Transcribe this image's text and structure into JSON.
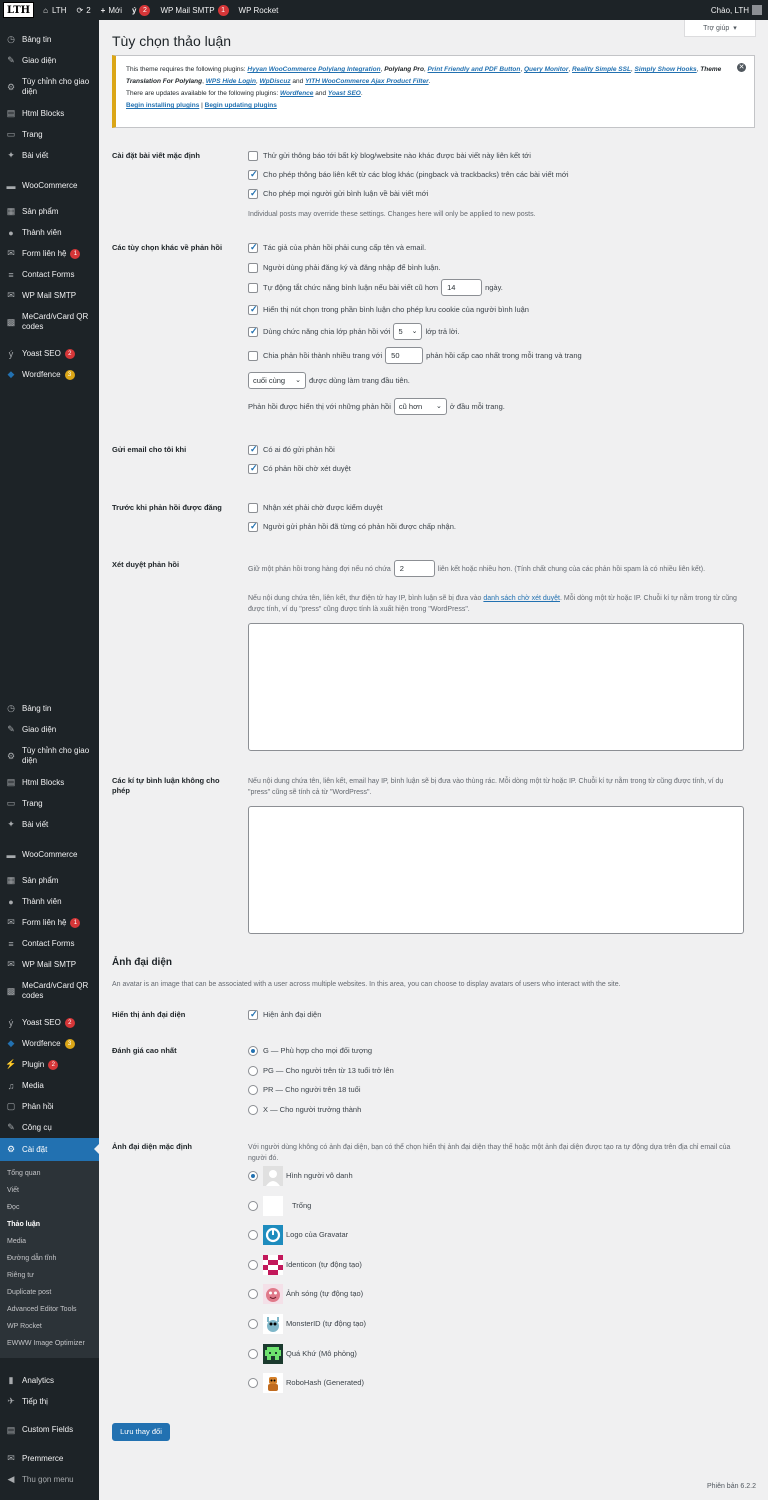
{
  "adminbar": {
    "logo": "LTH",
    "site_name": "LTH",
    "updates_count": "2",
    "new_label": "Mới",
    "yoast_count": "2",
    "smtp_label": "WP Mail SMTP",
    "smtp_count": "1",
    "rocket_label": "WP Rocket",
    "greeting": "Chào, LTH"
  },
  "sidebar": {
    "top_items": [
      {
        "label": "Bảng tin",
        "icon": "dashboard-icon"
      },
      {
        "label": "Giao diện",
        "icon": "brush-icon"
      },
      {
        "label": "Tùy chỉnh cho giao diện",
        "icon": "customize-icon"
      },
      {
        "label": "Html Blocks",
        "icon": "blocks-icon"
      },
      {
        "label": "Trang",
        "icon": "page-icon"
      },
      {
        "label": "Bài viết",
        "icon": "pin-icon"
      },
      {
        "label": "WooCommerce",
        "icon": "woo-icon"
      },
      {
        "label": "Sản phẩm",
        "icon": "archive-icon"
      },
      {
        "label": "Thành viên",
        "icon": "user-icon"
      },
      {
        "label": "Form liên hệ",
        "icon": "mail-icon",
        "badge": "1"
      },
      {
        "label": "Contact Forms",
        "icon": "forms-icon"
      },
      {
        "label": "WP Mail SMTP",
        "icon": "smtp-icon"
      },
      {
        "label": "MeCard/vCard QR codes",
        "icon": "qr-icon"
      },
      {
        "label": "Yoast SEO",
        "icon": "yoast-icon",
        "badge": "2"
      },
      {
        "label": "Wordfence",
        "icon": "wordfence-icon",
        "badge": "3"
      }
    ],
    "bottom_items": [
      {
        "label": "Bảng tin"
      },
      {
        "label": "Giao diện"
      },
      {
        "label": "Tùy chỉnh cho giao diện"
      },
      {
        "label": "Html Blocks"
      },
      {
        "label": "Trang"
      },
      {
        "label": "Bài viết"
      },
      {
        "label": "WooCommerce"
      },
      {
        "label": "Sản phẩm"
      },
      {
        "label": "Thành viên"
      },
      {
        "label": "Form liên hệ",
        "badge": "1"
      },
      {
        "label": "Contact Forms"
      },
      {
        "label": "WP Mail SMTP"
      },
      {
        "label": "MeCard/vCard QR codes"
      },
      {
        "label": "Yoast SEO",
        "badge": "2"
      },
      {
        "label": "Wordfence",
        "badge": "3"
      },
      {
        "label": "Plugin",
        "badge": "2"
      },
      {
        "label": "Media"
      },
      {
        "label": "Phản hồi"
      },
      {
        "label": "Công cụ"
      },
      {
        "label": "Cài đặt"
      }
    ],
    "submenu": [
      "Tổng quan",
      "Viết",
      "Đọc",
      "Thảo luận",
      "Media",
      "Đường dẫn tĩnh",
      "Riêng tư",
      "Duplicate post",
      "Advanced Editor Tools",
      "WP Rocket",
      "EWWW Image Optimizer"
    ],
    "extra_items": [
      "Analytics",
      "Tiếp thị",
      "Custom Fields",
      "Premmerce",
      "Thu gọn menu"
    ]
  },
  "help_tab": "Trợ giúp",
  "page_title": "Tùy chọn thảo luận",
  "notice": {
    "line1_prefix": "This theme requires the following plugins:",
    "required_plugins": [
      "Hyyan WooCommerce Polylang Integration",
      "Polylang Pro",
      "Print Friendly and PDF Button",
      "Query Monitor",
      "Reality Simple SSL",
      "Simply Show Hooks",
      "Theme Translation For Polylang",
      "WPS Hide Login",
      "WpDiscuz",
      "YITH WooCommerce Ajax Product Filter"
    ],
    "line3_prefix": "There are updates available for the following plugins:",
    "update_plugins": [
      "Wordfence",
      "Yoast SEO"
    ],
    "and_word": "and",
    "action_install": "Begin installing plugins",
    "action_update": "Begin updating plugins"
  },
  "default_settings": {
    "label": "Cài đặt bài viết mặc định",
    "options": [
      {
        "text": "Thử gửi thông báo tới bất kỳ blog/website nào khác được bài viết này liên kết tới",
        "checked": false
      },
      {
        "text": "Cho phép thông báo liên kết từ các blog khác (pingback và trackbacks) trên các bài viết mới",
        "checked": true
      },
      {
        "text": "Cho phép mọi người gửi bình luận về bài viết mới",
        "checked": true
      }
    ],
    "note": "Individual posts may override these settings. Changes here will only be applied to new posts."
  },
  "other_settings": {
    "label": "Các tùy chọn khác về phản hồi",
    "name_email": {
      "text": "Tác giả của phản hồi phải cung cấp tên và email.",
      "checked": true
    },
    "registered": {
      "text": "Người dùng phải đăng ký và đăng nhập để bình luận.",
      "checked": false
    },
    "close_prefix": "Tự động tắt chức năng bình luận nếu bài viết cũ hơn",
    "close_days": "14",
    "close_suffix": "ngày.",
    "close_checked": false,
    "cookies": {
      "text": "Hiển thị nút chọn trong phần bình luận cho phép lưu cookie của người bình luận",
      "checked": true
    },
    "thread_prefix": "Dùng chức năng chia lớp phản hồi với",
    "thread_depth": "5",
    "thread_suffix": "lớp trả lời.",
    "thread_checked": true,
    "pages_prefix": "Chia phản hồi thành nhiều trang với",
    "pages_count": "50",
    "pages_suffix": "phản hồi cấp cao nhất trong mỗi trang và trang",
    "pages_checked": false,
    "default_page": "cuối cùng",
    "default_page_suffix": "được dùng làm trang đầu tiên.",
    "order_prefix": "Phản hồi được hiển thị với những phản hồi",
    "order_value": "cũ hơn",
    "order_suffix": "ở đầu mỗi trang."
  },
  "email_me": {
    "label": "Gửi email cho tôi khi",
    "options": [
      {
        "text": "Có ai đó gửi phản hồi",
        "checked": true
      },
      {
        "text": "Có phản hồi chờ xét duyệt",
        "checked": true
      }
    ]
  },
  "before_appear": {
    "label": "Trước khi phản hồi được đăng",
    "options": [
      {
        "text": "Nhận xét phải chờ được kiểm duyệt",
        "checked": false
      },
      {
        "text": "Người gửi phản hồi đã từng có phản hồi được chấp nhận.",
        "checked": true
      }
    ]
  },
  "moderation": {
    "label": "Xét duyệt phản hồi",
    "hold_prefix": "Giữ một phản hồi trong hàng đợi nếu nó chứa",
    "links_count": "2",
    "hold_suffix": "liên kết hoặc nhiều hơn. (Tính chất chung của các phản hồi spam là có nhiều liên kết).",
    "desc_prefix": "Nếu nội dung chứa tên, liên kết, thư điện tử hay IP, bình luận sẽ bị đưa vào",
    "desc_link": "danh sách chờ xét duyệt",
    "desc_suffix": ". Mỗi dòng một từ hoặc IP. Chuỗi kí tự nằm trong từ cũng được tính, ví dụ \"press\" cũng được tính là xuất hiện trong \"WordPress\"."
  },
  "disallowed": {
    "label": "Các kí tự bình luận không cho phép",
    "desc": "Nếu nội dung chứa tên, liên kết, email hay IP, bình luận sẽ bị đưa vào thùng rác. Mỗi dòng một từ hoặc IP. Chuỗi kí tự nằm trong từ cũng được tính, ví dụ \"press\" cũng sẽ tính cả từ \"WordPress\"."
  },
  "avatars": {
    "heading": "Ảnh đại diện",
    "intro": "An avatar is an image that can be associated with a user across multiple websites. In this area, you can choose to display avatars of users who interact with the site.",
    "display_label": "Hiển thị ảnh đại diện",
    "display_text": "Hiện ảnh đại diện",
    "display_checked": true,
    "rating_label": "Đánh giá cao nhất",
    "ratings": [
      {
        "text": "G — Phù hợp cho mọi đối tượng",
        "checked": true
      },
      {
        "text": "PG — Cho người trên từ 13 tuổi trở lên",
        "checked": false
      },
      {
        "text": "PR — Cho người trên 18 tuổi",
        "checked": false
      },
      {
        "text": "X — Cho người trưởng thành",
        "checked": false
      }
    ],
    "default_label": "Ảnh đại diện mặc định",
    "default_desc": "Với người dùng không có ảnh đại diện, bạn có thể chọn hiển thị ảnh đại diện thay thế hoặc một ảnh đại diện được tạo ra tự động dựa trên địa chỉ email của người đó.",
    "defaults": [
      {
        "text": "Hình người vô danh",
        "icon": "mystery-person-icon",
        "checked": true
      },
      {
        "text": "Trống",
        "icon": "blank-icon",
        "checked": false
      },
      {
        "text": "Logo của Gravatar",
        "icon": "gravatar-logo-icon",
        "checked": false
      },
      {
        "text": "Identicon (tự động tạo)",
        "icon": "identicon-icon",
        "checked": false
      },
      {
        "text": "Ảnh sóng (tự động tạo)",
        "icon": "wavatar-icon",
        "checked": false
      },
      {
        "text": "MonsterID (tự động tạo)",
        "icon": "monsterid-icon",
        "checked": false
      },
      {
        "text": "Quá Khứ (Mô phỏng)",
        "icon": "retro-icon",
        "checked": false
      },
      {
        "text": "RoboHash (Generated)",
        "icon": "robohash-icon",
        "checked": false
      }
    ]
  },
  "save_button": "Lưu thay đổi",
  "version": "Phiên bản 6.2.2",
  "colors": {
    "accent": "#2271b1",
    "sidebar": "#1d2327",
    "badge": "#d63638",
    "warning": "#dba617"
  }
}
